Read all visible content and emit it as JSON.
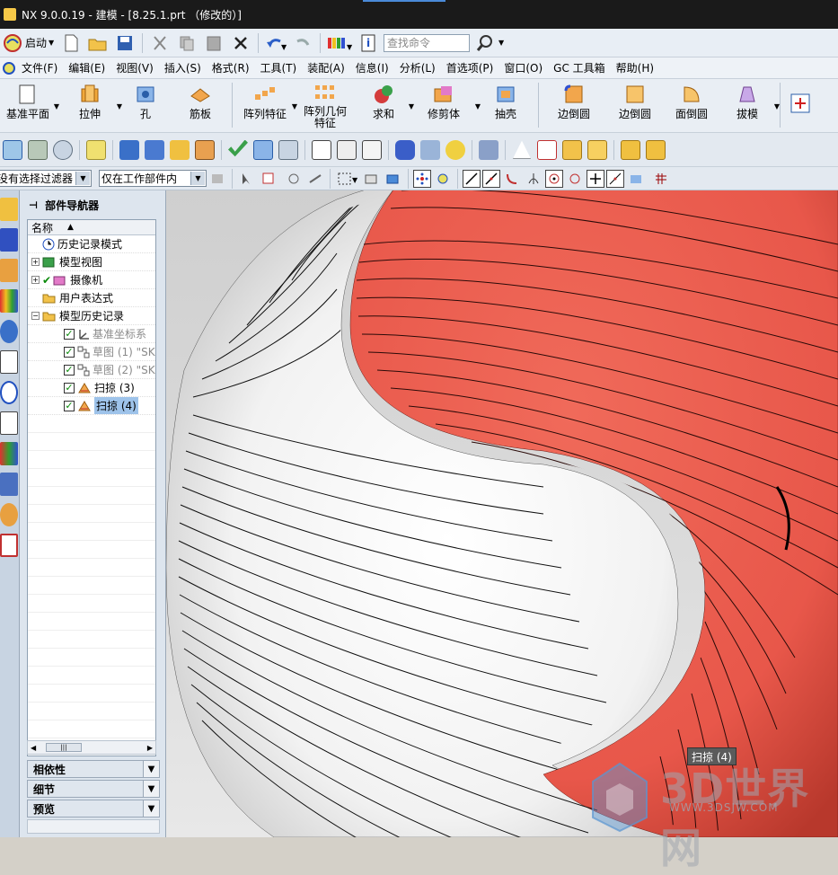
{
  "window": {
    "title": "NX 9.0.0.19 - 建模 - [8.25.1.prt （修改的）]"
  },
  "standard_toolbar": {
    "start_label": "启动",
    "search_placeholder": "查找命令"
  },
  "menu": [
    "文件(F)",
    "编辑(E)",
    "视图(V)",
    "插入(S)",
    "格式(R)",
    "工具(T)",
    "装配(A)",
    "信息(I)",
    "分析(L)",
    "首选项(P)",
    "窗口(O)",
    "GC 工具箱",
    "帮助(H)"
  ],
  "feature_toolbar": {
    "datum_plane": "基准平面",
    "extrude": "拉伸",
    "hole": "孔",
    "rib": "筋板",
    "pattern_feature": "阵列特征",
    "pattern_geometry_1": "阵列几何",
    "pattern_geometry_2": "特征",
    "unite": "求和",
    "trim_body": "修剪体",
    "shell": "抽壳",
    "edge_blend_1": "边倒圆",
    "edge_blend_2": "边倒圆",
    "face_blend": "面倒圆",
    "draft": "拔模"
  },
  "selection_bar": {
    "filter": "没有选择过滤器",
    "scope": "仅在工作部件内"
  },
  "navigator": {
    "title": "部件导航器",
    "column_name": "名称",
    "items": [
      {
        "label": "历史记录模式"
      },
      {
        "label": "模型视图"
      },
      {
        "label": "摄像机"
      },
      {
        "label": "用户表达式"
      },
      {
        "label": "模型历史记录"
      },
      {
        "label": "基准坐标系"
      },
      {
        "label": "草图 (1) \"SK"
      },
      {
        "label": "草图 (2) \"SK"
      },
      {
        "label": "扫掠 (3)"
      },
      {
        "label": "扫掠 (4)"
      }
    ],
    "panels": [
      "相依性",
      "细节",
      "预览"
    ]
  },
  "viewport": {
    "tooltip": "扫掠 (4)",
    "watermark_text": "3D世界网",
    "watermark_url": "WWW.3DSJW.COM"
  },
  "colors": {
    "red_body": "#e8574a",
    "white_body": "#f4f4f4",
    "accent": "#4a8ad8"
  }
}
